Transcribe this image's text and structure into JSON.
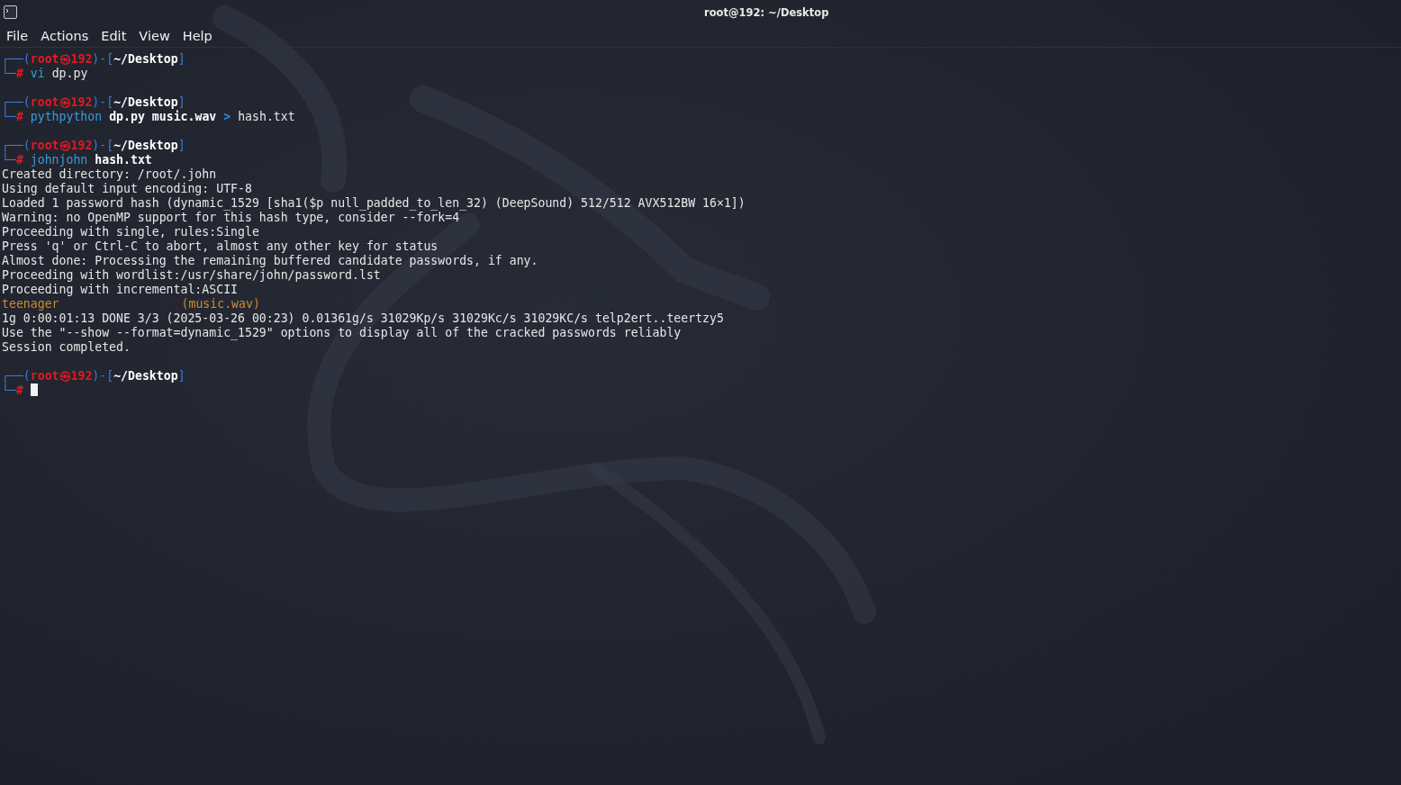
{
  "window": {
    "title": "root@192: ~/Desktop"
  },
  "menu": [
    "File",
    "Actions",
    "Edit",
    "View",
    "Help"
  ],
  "terminal": [
    {
      "kind": "prompt",
      "open": "┌──(",
      "user": "root",
      "mark": "㉿",
      "host": "192",
      "mid": ")-[",
      "path": "~/Desktop",
      "close": "]",
      "corner": "└─",
      "sign": "#",
      "cursor": false,
      "command": [
        {
          "kind": "cmd",
          "text": "vi"
        },
        {
          "kind": "plain",
          "text": "dp.py"
        }
      ]
    },
    {
      "kind": "blank"
    },
    {
      "kind": "prompt",
      "open": "┌──(",
      "user": "root",
      "mark": "㉿",
      "host": "192",
      "mid": ")-[",
      "path": "~/Desktop",
      "close": "]",
      "corner": "└─",
      "sign": "#",
      "cursor": false,
      "command": [
        {
          "kind": "cmd",
          "text": "pythpython"
        },
        {
          "kind": "arg",
          "text": "dp.py"
        },
        {
          "kind": "arg",
          "text": "music.wav"
        },
        {
          "kind": "op",
          "text": ">"
        },
        {
          "kind": "plain",
          "text": "hash.txt"
        }
      ]
    },
    {
      "kind": "blank"
    },
    {
      "kind": "prompt",
      "open": "┌──(",
      "user": "root",
      "mark": "㉿",
      "host": "192",
      "mid": ")-[",
      "path": "~/Desktop",
      "close": "]",
      "corner": "└─",
      "sign": "#",
      "cursor": false,
      "command": [
        {
          "kind": "cmd",
          "text": "johnjohn"
        },
        {
          "kind": "arg",
          "text": "hash.txt"
        }
      ]
    },
    {
      "kind": "output",
      "text": "Created directory: /root/.john"
    },
    {
      "kind": "output",
      "text": "Using default input encoding: UTF-8"
    },
    {
      "kind": "output",
      "text": "Loaded 1 password hash (dynamic_1529 [sha1($p null_padded_to_len_32) (DeepSound) 512/512 AVX512BW 16×1])"
    },
    {
      "kind": "output",
      "text": "Warning: no OpenMP support for this hash type, consider --fork=4"
    },
    {
      "kind": "output",
      "text": "Proceeding with single, rules:Single"
    },
    {
      "kind": "output",
      "text": "Press 'q' or Ctrl-C to abort, almost any other key for status"
    },
    {
      "kind": "output",
      "text": "Almost done: Processing the remaining buffered candidate passwords, if any."
    },
    {
      "kind": "output",
      "text": "Proceeding with wordlist:/usr/share/john/password.lst"
    },
    {
      "kind": "output",
      "text": "Proceeding with incremental:ASCII"
    },
    {
      "kind": "cracked",
      "password": "teenager",
      "source": "(music.wav)"
    },
    {
      "kind": "output",
      "text": "1g 0:00:01:13 DONE 3/3 (2025-03-26 00:23) 0.01361g/s 31029Kp/s 31029Kc/s 31029KC/s telp2ert..teertzy5"
    },
    {
      "kind": "output",
      "text": "Use the \"--show --format=dynamic_1529\" options to display all of the cracked passwords reliably"
    },
    {
      "kind": "output",
      "text": "Session completed."
    },
    {
      "kind": "blank"
    },
    {
      "kind": "prompt",
      "open": "┌──(",
      "user": "root",
      "mark": "㉿",
      "host": "192",
      "mid": ")-[",
      "path": "~/Desktop",
      "close": "]",
      "corner": "└─",
      "sign": "#",
      "cursor": true
    }
  ]
}
